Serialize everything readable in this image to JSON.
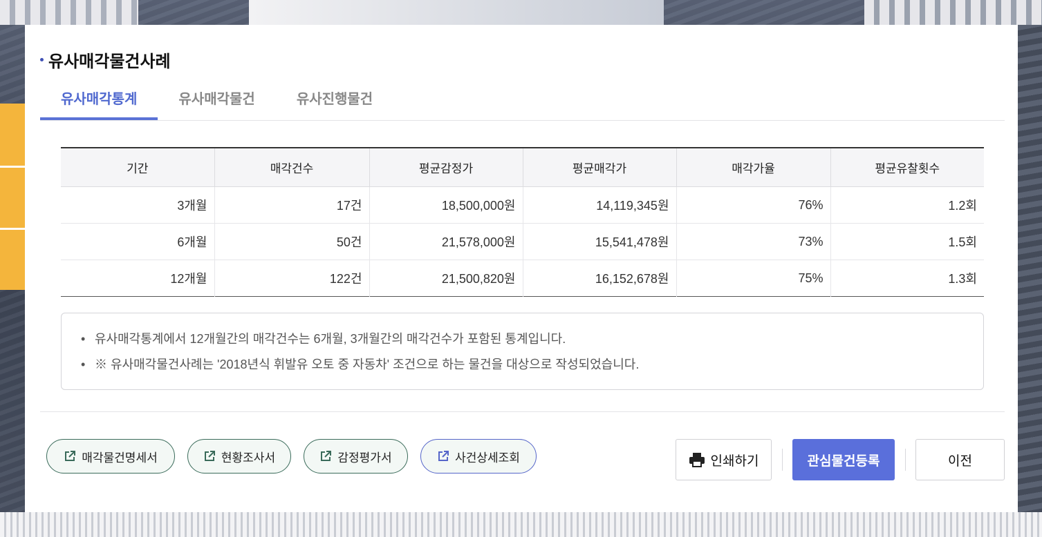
{
  "section": {
    "title": "유사매각물건사례"
  },
  "tabs": [
    {
      "label": "유사매각통계",
      "active": true
    },
    {
      "label": "유사매각물건",
      "active": false
    },
    {
      "label": "유사진행물건",
      "active": false
    }
  ],
  "table": {
    "headers": [
      "기간",
      "매각건수",
      "평균감정가",
      "평균매각가",
      "매각가율",
      "평균유찰횟수"
    ],
    "rows": [
      [
        "3개월",
        "17건",
        "18,500,000원",
        "14,119,345원",
        "76%",
        "1.2회"
      ],
      [
        "6개월",
        "50건",
        "21,578,000원",
        "15,541,478원",
        "73%",
        "1.5회"
      ],
      [
        "12개월",
        "122건",
        "21,500,820원",
        "16,152,678원",
        "75%",
        "1.3회"
      ]
    ]
  },
  "notes": [
    "유사매각통계에서 12개월간의 매각건수는 6개월, 3개월간의 매각건수가 포함된 통계입니다.",
    "※ 유사매각물건사례는 '2018년식 휘발유 오토 중 자동차' 조건으로 하는 물건을 대상으로 작성되었습니다."
  ],
  "doc_buttons": [
    {
      "label": "매각물건명세서",
      "icon": "external-link-icon"
    },
    {
      "label": "현황조사서",
      "icon": "external-link-icon"
    },
    {
      "label": "감정평가서",
      "icon": "external-link-icon"
    },
    {
      "label": "사건상세조회",
      "icon": "external-link-icon"
    }
  ],
  "actions": {
    "print": {
      "label": "인쇄하기",
      "icon": "printer-icon"
    },
    "favorite": "관심물건등록",
    "previous": "이전"
  },
  "colors": {
    "accent": "#5a6fdb",
    "tab_active": "#4f68cf",
    "doc_border_green": "#3a6b5a",
    "doc_border_blue": "#5565c9"
  }
}
